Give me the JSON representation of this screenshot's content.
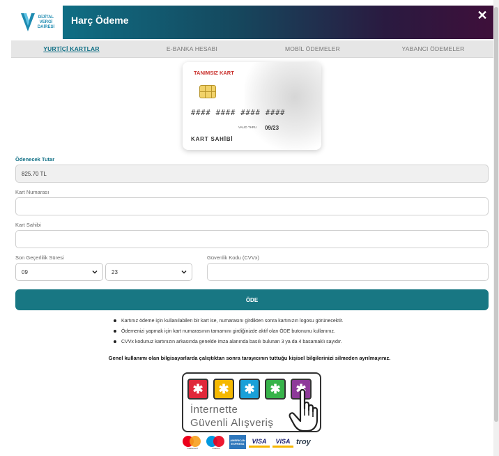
{
  "header": {
    "logo_text": [
      "DİJİTAL",
      "VERGİ",
      "DAİRESİ"
    ],
    "title": "Harç Ödeme",
    "close_label": "✕"
  },
  "tabs": [
    {
      "label": "YURTİÇİ KARTLAR",
      "active": true
    },
    {
      "label": "E-BANKA HESABI",
      "active": false
    },
    {
      "label": "MOBİL ÖDEMELER",
      "active": false
    },
    {
      "label": "YABANCI ÖDEMELER",
      "active": false
    }
  ],
  "card_preview": {
    "brand": "TANIMSIZ KART",
    "number": "#### #### #### ####",
    "valid_label": "VALID THRU",
    "valid_value": "09/23",
    "holder": "KART SAHİBİ"
  },
  "form": {
    "amount_label": "Ödenecek Tutar",
    "amount_value": "825.70 TL",
    "card_number_label": "Kart Numarası",
    "card_number_value": "",
    "card_holder_label": "Kart Sahibi",
    "card_holder_value": "",
    "expiry_label": "Son Geçerlilik Süresi",
    "expiry_month": "09",
    "expiry_year": "23",
    "cvv_label": "Güvenlik Kodu (CVVx)",
    "cvv_value": "",
    "pay_button": "ÖDE"
  },
  "info_items": [
    "Kartınız ödeme için kullanılabilen bir kart ise, numarasını girdikten sonra kartınızın logosu görünecektir.",
    "Ödemenizi yapmak için kart numarasının tamamını girdiğinizde aktif olan ÖDE butonunu kullanınız.",
    "CVVx kodunuz kartınızın arkasında genelde imza alanında basılı bulunan 3 ya da 4 basamaklı sayıdır."
  ],
  "warning": "Genel kullanımı olan bilgisayarlarda çalıştıktan sonra tarayıcının tuttuğu kişisel bilgilerinizi silmeden ayrılmayınız.",
  "secure_badge": {
    "line1": "İnternette",
    "line2": "Güvenli Alışveriş",
    "tile_colors": [
      "#e0283a",
      "#f5b800",
      "#1aa0d8",
      "#37b34a",
      "#8e3a9a"
    ]
  },
  "payment_logos": {
    "mastercard_sub": "mastercard",
    "maestro_sub": "maestro",
    "amex": "AMERICAN EXPRESS",
    "visa1": "VISA",
    "visa2": "VISA",
    "troy": "troy"
  },
  "colors": {
    "primary": "#187783",
    "header_gradient_end": "#3e0f3a",
    "card_brand": "#c9302c"
  }
}
